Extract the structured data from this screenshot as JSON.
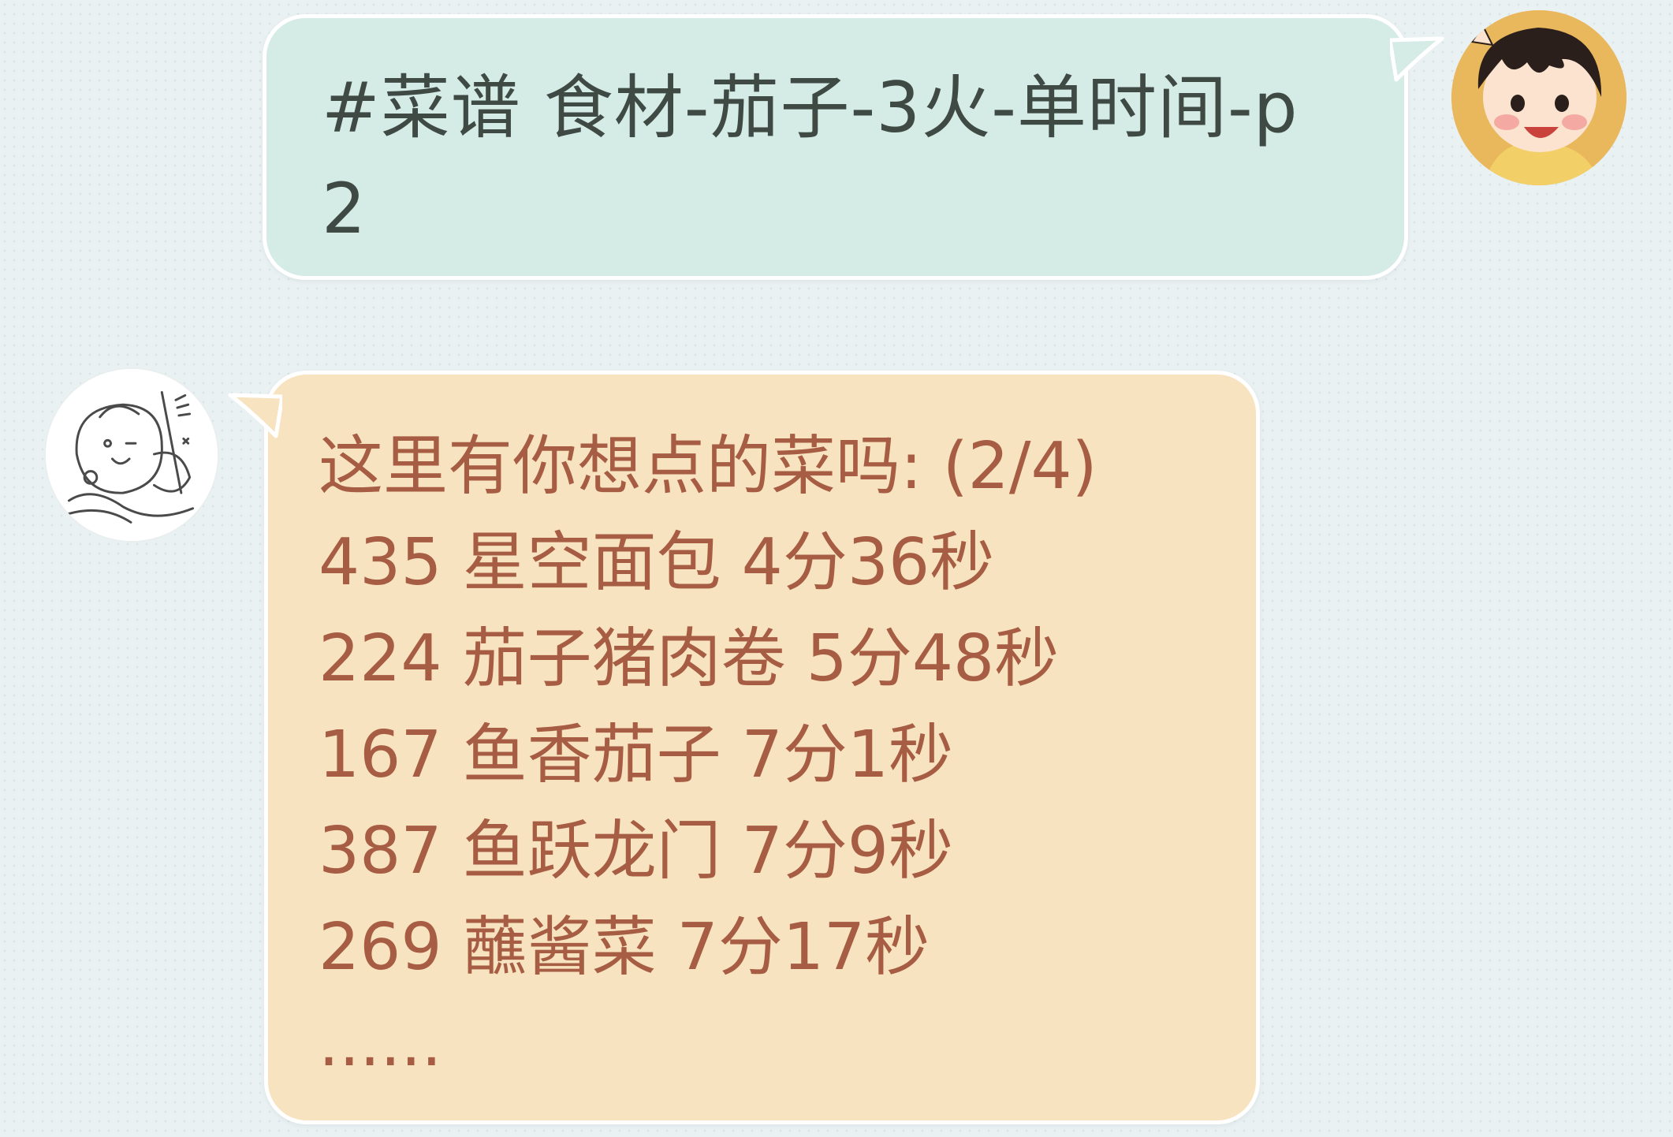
{
  "chat": {
    "outgoing": {
      "sender_avatar": "girl-avatar",
      "text": "#菜谱 食材-茄子-3火-单时间-p2",
      "bubble_color": "#d4ebe6",
      "text_color": "#3f4a45"
    },
    "incoming": {
      "sender_avatar": "cartoon-bird-avatar",
      "bubble_color": "#f8e3c1",
      "text_color": "#a65d43",
      "header": "这里有你想点的菜吗: (2/4)",
      "lines": [
        "435 星空面包 4分36秒",
        "224 茄子猪肉卷 5分48秒",
        "167 鱼香茄子 7分1秒",
        "387 鱼跃龙门 7分9秒",
        "269 蘸酱菜 7分17秒"
      ],
      "ellipsis": "......"
    }
  }
}
